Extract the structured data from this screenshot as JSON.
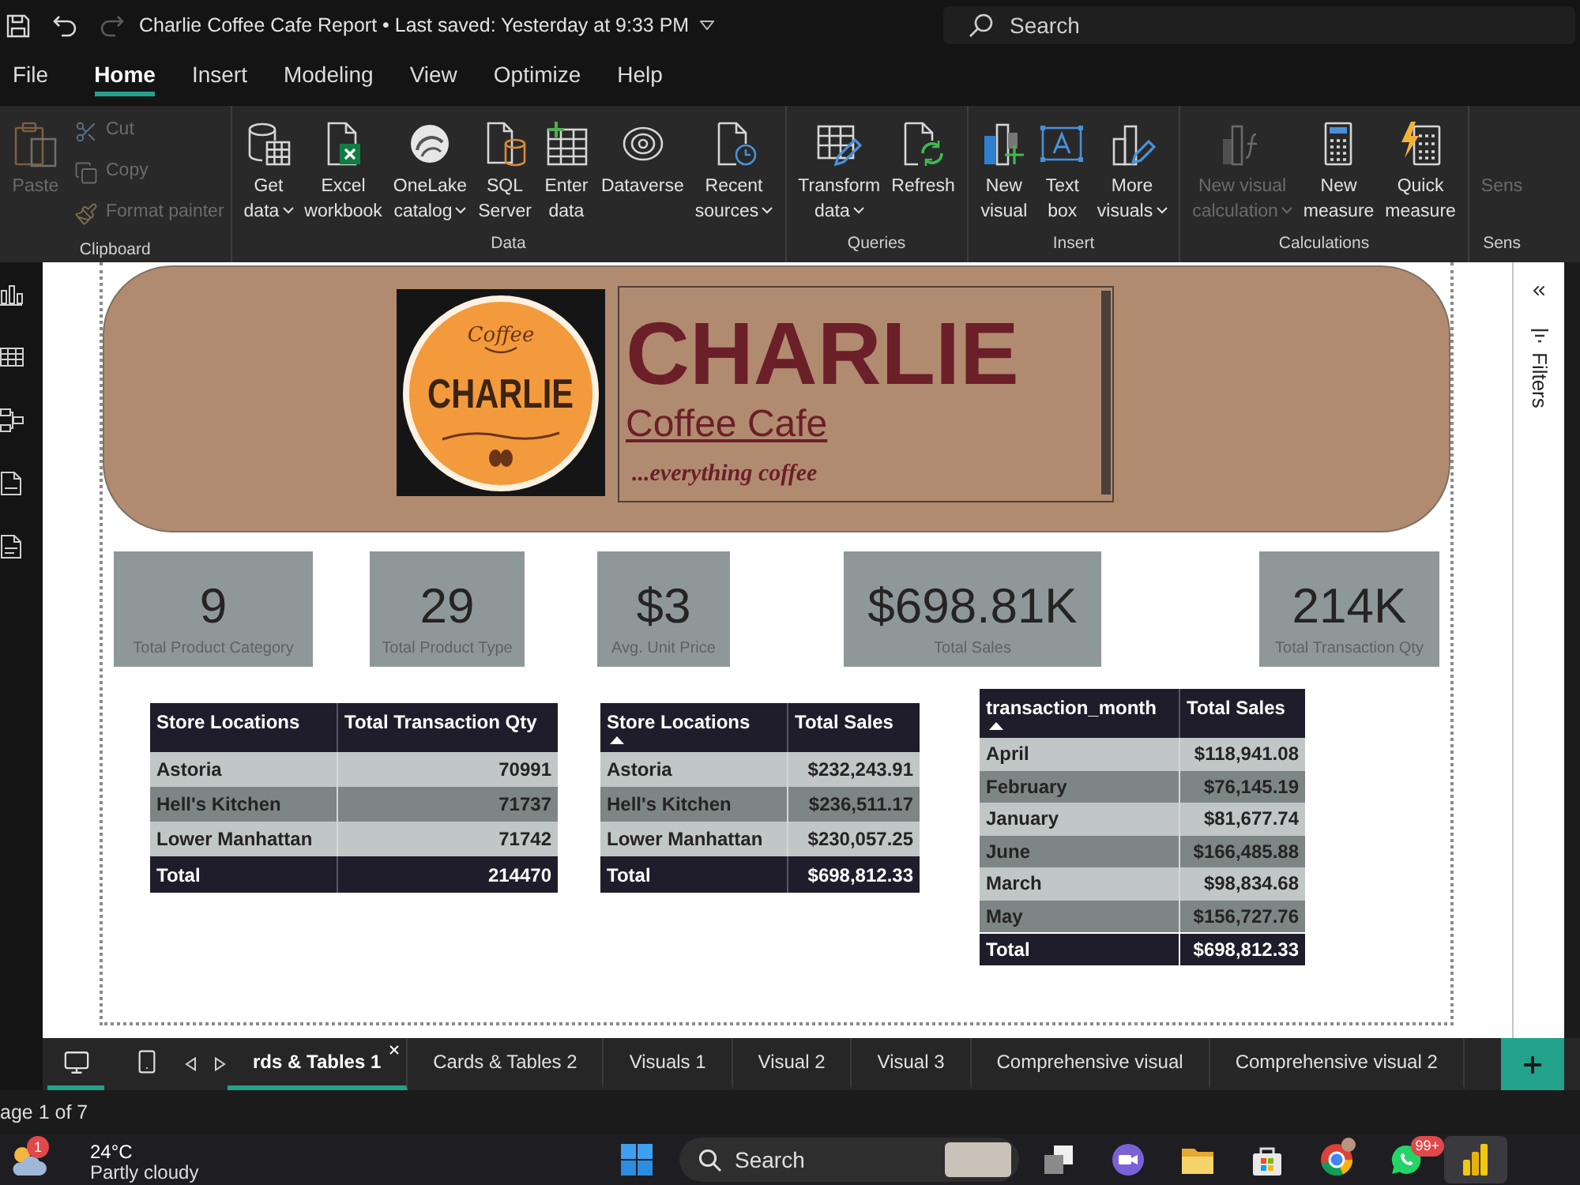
{
  "title_bar": {
    "quick_access": [
      {
        "kind": "save",
        "disabled": false
      },
      {
        "kind": "undo",
        "disabled": false
      },
      {
        "kind": "redo",
        "disabled": true
      }
    ],
    "title": "Charlie Coffee Cafe Report • Last saved: Yesterday at 9:33 PM",
    "search": {
      "placeholder": "Search"
    }
  },
  "menu": [
    {
      "label": "File",
      "selected": false
    },
    {
      "label": "Home",
      "selected": true
    },
    {
      "label": "Insert",
      "selected": false
    },
    {
      "label": "Modeling",
      "selected": false
    },
    {
      "label": "View",
      "selected": false
    },
    {
      "label": "Optimize",
      "selected": false
    },
    {
      "label": "Help",
      "selected": false
    }
  ],
  "ribbon": [
    {
      "label": "Clipboard",
      "buttons": [
        {
          "kind": "paste",
          "lines": [
            "Paste"
          ],
          "disabled": true,
          "dropdown": false
        },
        {
          "kind": "cut",
          "lines": [
            "Cut"
          ],
          "disabled": true,
          "dropdown": false
        },
        {
          "kind": "copy",
          "lines": [
            "Copy"
          ],
          "disabled": true,
          "dropdown": false
        },
        {
          "kind": "format_painter",
          "lines": [
            "Format painter"
          ],
          "disabled": true,
          "dropdown": false
        }
      ]
    },
    {
      "label": "Data",
      "buttons": [
        {
          "kind": "get_data",
          "lines": [
            "Get",
            "data"
          ],
          "disabled": false,
          "dropdown": true
        },
        {
          "kind": "excel",
          "lines": [
            "Excel",
            "workbook"
          ],
          "disabled": false,
          "dropdown": false
        },
        {
          "kind": "onelake",
          "lines": [
            "OneLake",
            "catalog"
          ],
          "disabled": false,
          "dropdown": true
        },
        {
          "kind": "sql_server",
          "lines": [
            "SQL",
            "Server"
          ],
          "disabled": false,
          "dropdown": false
        },
        {
          "kind": "enter_data",
          "lines": [
            "Enter",
            "data"
          ],
          "disabled": false,
          "dropdown": false
        },
        {
          "kind": "dataverse",
          "lines": [
            "Dataverse"
          ],
          "disabled": false,
          "dropdown": false
        },
        {
          "kind": "recent_sources",
          "lines": [
            "Recent",
            "sources"
          ],
          "disabled": false,
          "dropdown": true
        }
      ]
    },
    {
      "label": "Queries",
      "buttons": [
        {
          "kind": "transform",
          "lines": [
            "Transform",
            "data"
          ],
          "disabled": false,
          "dropdown": true
        },
        {
          "kind": "refresh",
          "lines": [
            "Refresh"
          ],
          "disabled": false,
          "dropdown": false
        }
      ]
    },
    {
      "label": "Insert",
      "buttons": [
        {
          "kind": "new_visual",
          "lines": [
            "New",
            "visual"
          ],
          "disabled": false,
          "dropdown": false
        },
        {
          "kind": "text_box",
          "lines": [
            "Text",
            "box"
          ],
          "disabled": false,
          "dropdown": false
        },
        {
          "kind": "more_visuals",
          "lines": [
            "More",
            "visuals"
          ],
          "disabled": false,
          "dropdown": true
        }
      ]
    },
    {
      "label": "Calculations",
      "buttons": [
        {
          "kind": "visual_calculation",
          "lines": [
            "New visual",
            "calculation"
          ],
          "disabled": true,
          "dropdown": true
        },
        {
          "kind": "new_measure",
          "lines": [
            "New",
            "measure"
          ],
          "disabled": false,
          "dropdown": false
        },
        {
          "kind": "quick_measure",
          "lines": [
            "Quick",
            "measure"
          ],
          "disabled": false,
          "dropdown": false
        }
      ]
    },
    {
      "label": "Sens",
      "buttons": [
        {
          "kind": "sensitivity",
          "lines": [
            "Sens"
          ],
          "disabled": true,
          "dropdown": false
        }
      ]
    }
  ],
  "report": {
    "banner": {
      "logo": {
        "script": "Coffee",
        "name": "CHARLIE"
      },
      "title": "CHARLIE",
      "subtitle": "Coffee Cafe",
      "tagline": "...everything coffee"
    },
    "cards": [
      {
        "value": "9",
        "label": "Total Product Category"
      },
      {
        "value": "29",
        "label": "Total Product Type"
      },
      {
        "value": "$3",
        "label": "Avg. Unit Price"
      },
      {
        "value": "$698.81K",
        "label": "Total Sales"
      },
      {
        "value": "214K",
        "label": "Total Transaction Qty"
      }
    ],
    "tables": [
      {
        "columns": [
          {
            "label": "Store Locations",
            "sorted": false
          },
          {
            "label": "Total Transaction Qty",
            "sorted": false
          }
        ],
        "rows": [
          [
            "Astoria",
            "70991"
          ],
          [
            "Hell's Kitchen",
            "71737"
          ],
          [
            "Lower Manhattan",
            "71742"
          ]
        ],
        "total": [
          "Total",
          "214470"
        ]
      },
      {
        "columns": [
          {
            "label": "Store Locations",
            "sorted": true
          },
          {
            "label": "Total Sales",
            "sorted": false
          }
        ],
        "rows": [
          [
            "Astoria",
            "$232,243.91"
          ],
          [
            "Hell's Kitchen",
            "$236,511.17"
          ],
          [
            "Lower Manhattan",
            "$230,057.25"
          ]
        ],
        "total": [
          "Total",
          "$698,812.33"
        ]
      },
      {
        "columns": [
          {
            "label": "transaction_month",
            "sorted": true
          },
          {
            "label": "Total Sales",
            "sorted": false
          }
        ],
        "rows": [
          [
            "April",
            "$118,941.08"
          ],
          [
            "February",
            "$76,145.19"
          ],
          [
            "January",
            "$81,677.74"
          ],
          [
            "June",
            "$166,485.88"
          ],
          [
            "March",
            "$98,834.68"
          ],
          [
            "May",
            "$156,727.76"
          ]
        ],
        "total": [
          "Total",
          "$698,812.33"
        ]
      }
    ]
  },
  "filters_pane": {
    "label": "Filters"
  },
  "view_toggle": [
    {
      "kind": "desktop",
      "selected": true
    },
    {
      "kind": "mobile",
      "selected": false
    }
  ],
  "page_tabs": [
    {
      "label": "rds & Tables 1",
      "selected": true
    },
    {
      "label": "Cards & Tables 2",
      "selected": false
    },
    {
      "label": "Visuals 1",
      "selected": false
    },
    {
      "label": "Visual 2",
      "selected": false
    },
    {
      "label": "Visual 3",
      "selected": false
    },
    {
      "label": "Comprehensive visual",
      "selected": false
    },
    {
      "label": "Comprehensive visual 2",
      "selected": false
    }
  ],
  "status_bar": {
    "page": "age 1 of 7"
  },
  "taskbar": {
    "weather": {
      "badge": "1",
      "temperature": "24°C",
      "condition": "Partly cloudy"
    },
    "search": {
      "placeholder": "Search"
    },
    "apps": [
      {
        "kind": "task_view",
        "selected": false
      },
      {
        "kind": "meet",
        "selected": false
      },
      {
        "kind": "folder",
        "selected": false
      },
      {
        "kind": "store",
        "selected": false
      },
      {
        "kind": "browser",
        "selected": false
      },
      {
        "kind": "chat",
        "selected": false,
        "badge": "99+"
      },
      {
        "kind": "powerbi",
        "selected": true
      }
    ]
  }
}
